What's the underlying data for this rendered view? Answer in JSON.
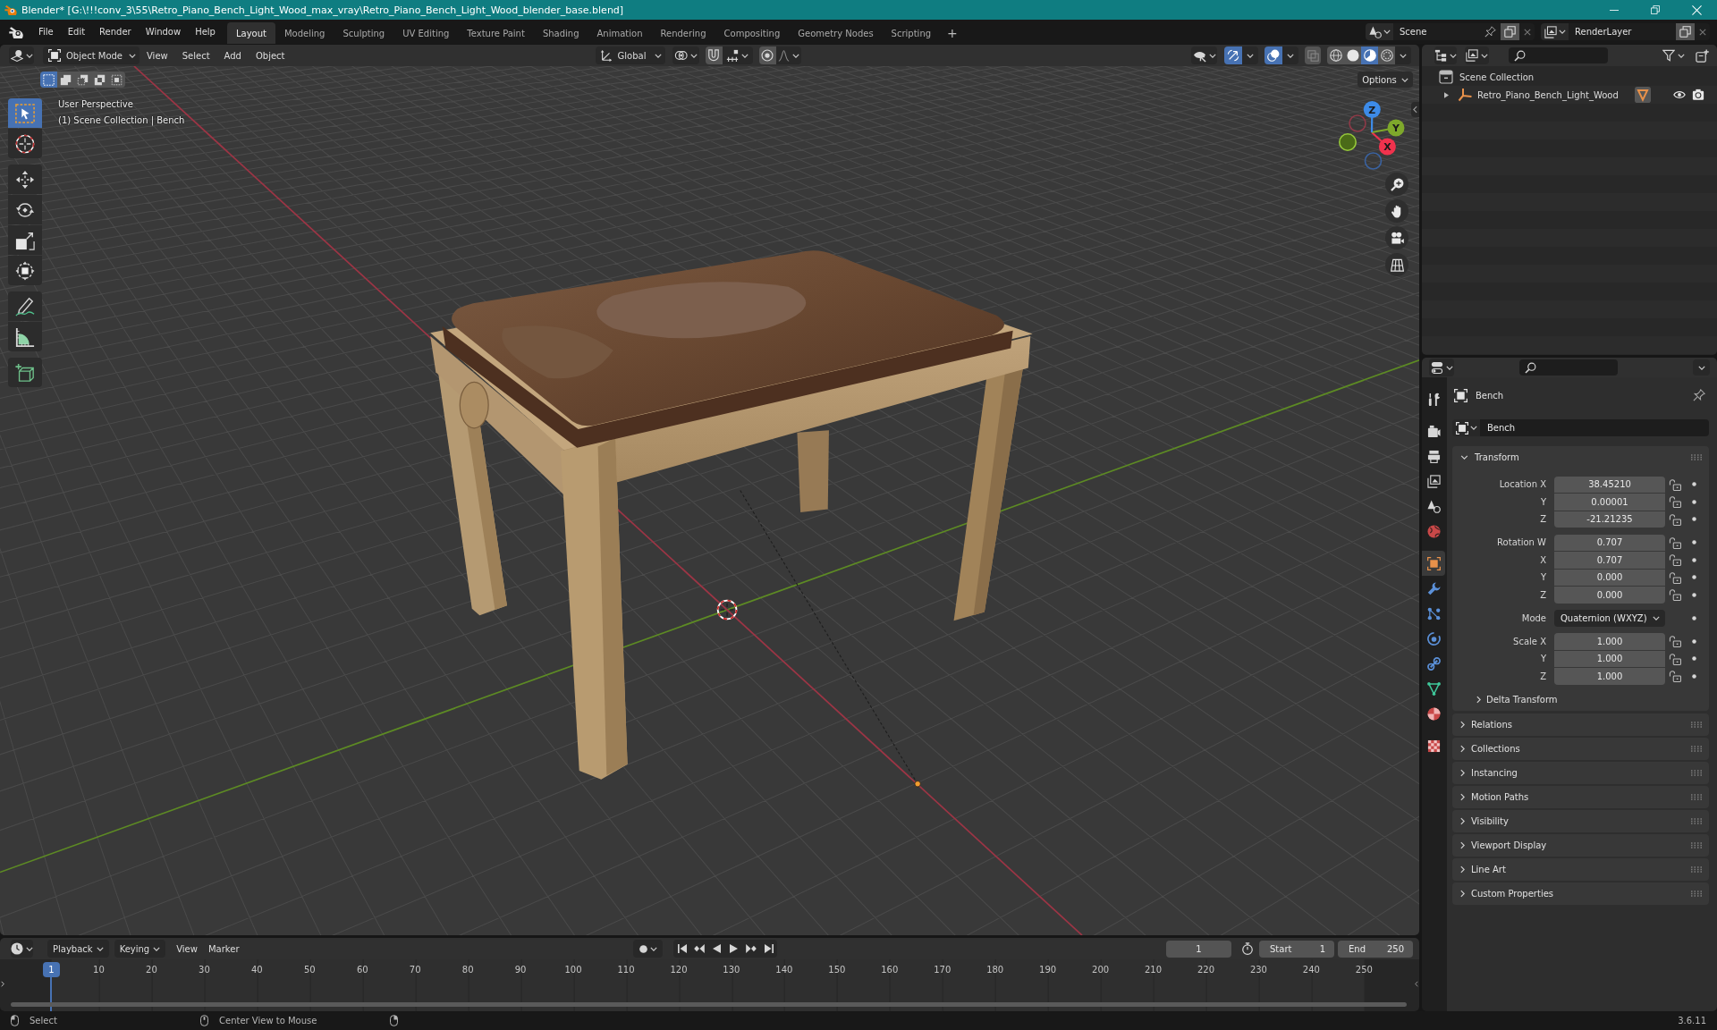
{
  "window": {
    "title": "Blender* [G:\\!!!conv_3\\55\\Retro_Piano_Bench_Light_Wood_max_vray\\Retro_Piano_Bench_Light_Wood_blender_base.blend]"
  },
  "menu": [
    "File",
    "Edit",
    "Render",
    "Window",
    "Help"
  ],
  "workspaces": [
    {
      "label": "Layout",
      "selected": true
    },
    {
      "label": "Modeling",
      "selected": false
    },
    {
      "label": "Sculpting",
      "selected": false
    },
    {
      "label": "UV Editing",
      "selected": false
    },
    {
      "label": "Texture Paint",
      "selected": false
    },
    {
      "label": "Shading",
      "selected": false
    },
    {
      "label": "Animation",
      "selected": false
    },
    {
      "label": "Rendering",
      "selected": false
    },
    {
      "label": "Compositing",
      "selected": false
    },
    {
      "label": "Geometry Nodes",
      "selected": false
    },
    {
      "label": "Scripting",
      "selected": false
    }
  ],
  "add_workspace": "+",
  "scene": {
    "name": "Scene"
  },
  "view_layer": {
    "name": "RenderLayer"
  },
  "viewport": {
    "header": {
      "mode": "Object Mode",
      "menus": [
        "View",
        "Select",
        "Add",
        "Object"
      ],
      "orientation": "Global",
      "snap": false,
      "proportional": false,
      "gizmos": true,
      "overlays": true,
      "xray": false,
      "shading": [
        {
          "kind": "wireframe",
          "selected": false
        },
        {
          "kind": "solid",
          "selected": false
        },
        {
          "kind": "material",
          "selected": true
        },
        {
          "kind": "rendered",
          "selected": false
        }
      ]
    },
    "select_modes": [
      {
        "kind": "set",
        "selected": true
      },
      {
        "kind": "extend",
        "selected": false
      },
      {
        "kind": "subtract",
        "selected": false
      },
      {
        "kind": "difference",
        "selected": false
      },
      {
        "kind": "intersect",
        "selected": false
      }
    ],
    "tool_groups": [
      [
        {
          "kind": "select",
          "selected": true
        },
        {
          "kind": "cursor",
          "selected": false
        }
      ],
      [
        {
          "kind": "move",
          "selected": false
        },
        {
          "kind": "rotate",
          "selected": false
        },
        {
          "kind": "scale",
          "selected": false
        },
        {
          "kind": "transform",
          "selected": false
        }
      ],
      [
        {
          "kind": "annotate",
          "selected": false
        },
        {
          "kind": "measure",
          "selected": false
        }
      ],
      [
        {
          "kind": "addcube",
          "selected": false
        }
      ]
    ],
    "options": "Options",
    "info": [
      "User Perspective",
      "(1) Scene Collection | Bench"
    ],
    "axes": [
      "X",
      "Y",
      "Z"
    ]
  },
  "outliner": {
    "root": "Scene Collection",
    "items": [
      {
        "label": "Retro_Piano_Bench_Light_Wood",
        "expanded": false,
        "visible": true,
        "renderable": true
      }
    ]
  },
  "properties": {
    "tab_groups": [
      [
        {
          "kind": "tool",
          "selected": false
        }
      ],
      [
        {
          "kind": "render",
          "selected": false
        },
        {
          "kind": "output",
          "selected": false
        },
        {
          "kind": "viewlayer",
          "selected": false
        },
        {
          "kind": "scene",
          "selected": false
        },
        {
          "kind": "world",
          "selected": false
        }
      ],
      [
        {
          "kind": "object",
          "selected": true
        },
        {
          "kind": "modifiers",
          "selected": false
        },
        {
          "kind": "particles",
          "selected": false
        },
        {
          "kind": "physics",
          "selected": false
        },
        {
          "kind": "constraints",
          "selected": false
        },
        {
          "kind": "data",
          "selected": false
        },
        {
          "kind": "material",
          "selected": false
        }
      ],
      [
        {
          "kind": "texture",
          "selected": false
        }
      ]
    ],
    "context": "Bench",
    "object_name": "Bench",
    "panels": [
      {
        "title": "Transform",
        "expanded": true,
        "groups": [
          {
            "rows": [
              {
                "kind": "number",
                "label": "Location X",
                "value": "38.45210",
                "locked": false
              },
              {
                "kind": "number",
                "label": "Y",
                "value": "0.00001",
                "locked": false
              },
              {
                "kind": "number",
                "label": "Z",
                "value": "-21.21235",
                "locked": false
              }
            ]
          },
          {
            "rows": [
              {
                "kind": "number",
                "label": "Rotation W",
                "value": "0.707",
                "locked": false
              },
              {
                "kind": "number",
                "label": "X",
                "value": "0.707",
                "locked": false
              },
              {
                "kind": "number",
                "label": "Y",
                "value": "0.000",
                "locked": false
              },
              {
                "kind": "number",
                "label": "Z",
                "value": "0.000",
                "locked": false
              }
            ]
          },
          {
            "rows": [
              {
                "kind": "dropdown",
                "label": "Mode",
                "value": "Quaternion (WXYZ)"
              }
            ]
          },
          {
            "rows": [
              {
                "kind": "number",
                "label": "Scale X",
                "value": "1.000",
                "locked": false
              },
              {
                "kind": "number",
                "label": "Y",
                "value": "1.000",
                "locked": false
              },
              {
                "kind": "number",
                "label": "Z",
                "value": "1.000",
                "locked": false
              }
            ]
          }
        ],
        "subpanels": [
          {
            "title": "Delta Transform",
            "expanded": false
          }
        ]
      },
      {
        "title": "Relations",
        "expanded": false
      },
      {
        "title": "Collections",
        "expanded": false
      },
      {
        "title": "Instancing",
        "expanded": false
      },
      {
        "title": "Motion Paths",
        "expanded": false
      },
      {
        "title": "Visibility",
        "expanded": false
      },
      {
        "title": "Viewport Display",
        "expanded": false
      },
      {
        "title": "Line Art",
        "expanded": false
      },
      {
        "title": "Custom Properties",
        "expanded": false
      }
    ]
  },
  "timeline": {
    "menus": [
      {
        "label": "Playback",
        "kind": "dropdown"
      },
      {
        "label": "Keying",
        "kind": "dropdown"
      },
      {
        "label": "View",
        "kind": "menu"
      },
      {
        "label": "Marker",
        "kind": "menu"
      }
    ],
    "auto_key": false,
    "current_frame": "1",
    "start_label": "Start",
    "start": "1",
    "end_label": "End",
    "end": "250",
    "playhead": "1",
    "ruler": [
      "10",
      "20",
      "30",
      "40",
      "50",
      "60",
      "70",
      "80",
      "90",
      "100",
      "110",
      "120",
      "130",
      "140",
      "150",
      "160",
      "170",
      "180",
      "190",
      "200",
      "210",
      "220",
      "230",
      "240",
      "250"
    ]
  },
  "status_bar": {
    "items": [
      {
        "kind": "left",
        "text": "Select"
      },
      {
        "kind": "middle",
        "text": "Center View to Mouse"
      },
      {
        "kind": "right"
      }
    ],
    "version": "3.6.11"
  }
}
